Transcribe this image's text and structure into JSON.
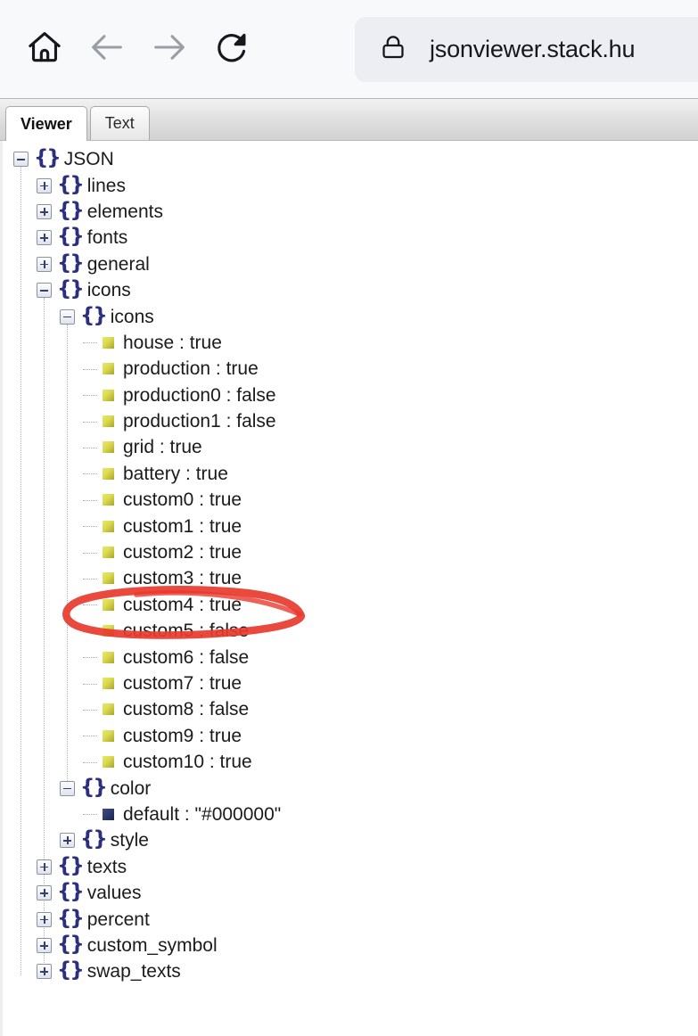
{
  "browser": {
    "home_icon": "home-icon",
    "back_icon": "back-arrow-icon",
    "forward_icon": "forward-arrow-icon",
    "reload_icon": "reload-icon",
    "lock_icon": "lock-icon",
    "url": "jsonviewer.stack.hu"
  },
  "tabs": [
    {
      "label": "Viewer",
      "active": true
    },
    {
      "label": "Text",
      "active": false
    }
  ],
  "colors": {
    "brace": "#2b2f7d",
    "bool_icon": "#d9d84f",
    "string_icon": "#2b3668",
    "annotation": "#e8392e"
  },
  "tree": {
    "root_label": "JSON",
    "rows": [
      {
        "depth": 0,
        "type": "object",
        "toggle": "minus",
        "label": "JSON"
      },
      {
        "depth": 1,
        "type": "object",
        "toggle": "plus",
        "label": "lines"
      },
      {
        "depth": 1,
        "type": "object",
        "toggle": "plus",
        "label": "elements"
      },
      {
        "depth": 1,
        "type": "object",
        "toggle": "plus",
        "label": "fonts"
      },
      {
        "depth": 1,
        "type": "object",
        "toggle": "plus",
        "label": "general"
      },
      {
        "depth": 1,
        "type": "object",
        "toggle": "minus",
        "label": "icons"
      },
      {
        "depth": 2,
        "type": "object",
        "toggle": "minus",
        "label": "icons"
      },
      {
        "depth": 3,
        "type": "bool",
        "label": "house : true"
      },
      {
        "depth": 3,
        "type": "bool",
        "label": "production : true"
      },
      {
        "depth": 3,
        "type": "bool",
        "label": "production0 : false"
      },
      {
        "depth": 3,
        "type": "bool",
        "label": "production1 : false"
      },
      {
        "depth": 3,
        "type": "bool",
        "label": "grid : true"
      },
      {
        "depth": 3,
        "type": "bool",
        "label": "battery : true",
        "annotated": true
      },
      {
        "depth": 3,
        "type": "bool",
        "label": "custom0 : true"
      },
      {
        "depth": 3,
        "type": "bool",
        "label": "custom1 : true"
      },
      {
        "depth": 3,
        "type": "bool",
        "label": "custom2 : true"
      },
      {
        "depth": 3,
        "type": "bool",
        "label": "custom3 : true"
      },
      {
        "depth": 3,
        "type": "bool",
        "label": "custom4 : true"
      },
      {
        "depth": 3,
        "type": "bool",
        "label": "custom5 : false"
      },
      {
        "depth": 3,
        "type": "bool",
        "label": "custom6 : false"
      },
      {
        "depth": 3,
        "type": "bool",
        "label": "custom7 : true"
      },
      {
        "depth": 3,
        "type": "bool",
        "label": "custom8 : false"
      },
      {
        "depth": 3,
        "type": "bool",
        "label": "custom9 : true"
      },
      {
        "depth": 3,
        "type": "bool",
        "label": "custom10 : true"
      },
      {
        "depth": 2,
        "type": "object",
        "toggle": "minus",
        "label": "color"
      },
      {
        "depth": 3,
        "type": "string",
        "label": "default : \"#000000\""
      },
      {
        "depth": 2,
        "type": "object",
        "toggle": "plus",
        "label": "style"
      },
      {
        "depth": 1,
        "type": "object",
        "toggle": "plus",
        "label": "texts"
      },
      {
        "depth": 1,
        "type": "object",
        "toggle": "plus",
        "label": "values"
      },
      {
        "depth": 1,
        "type": "object",
        "toggle": "plus",
        "label": "percent"
      },
      {
        "depth": 1,
        "type": "object",
        "toggle": "plus",
        "label": "custom_symbol"
      },
      {
        "depth": 1,
        "type": "object",
        "toggle": "plus",
        "label": "swap_texts"
      }
    ]
  }
}
